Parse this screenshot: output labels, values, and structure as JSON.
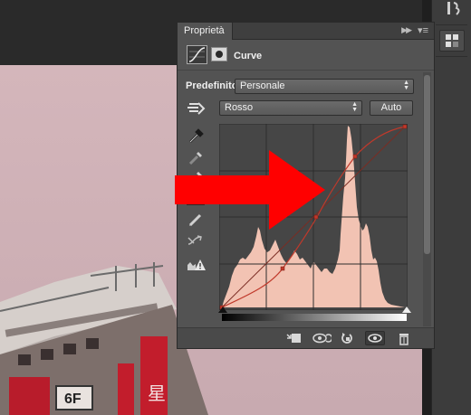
{
  "panel": {
    "tab_label": "Proprietà",
    "title": "Curve",
    "preset_label": "Predefinito:",
    "preset_value": "Personale",
    "channel_value": "Rosso",
    "auto_label": "Auto"
  },
  "dock": {
    "items": [
      "history-icon",
      "adjustments-icon"
    ]
  },
  "icons": {
    "tools": [
      "target-adjust-icon",
      "black-eyedropper-icon",
      "gray-eyedropper-icon",
      "white-eyedropper-icon",
      "edit-points-icon",
      "pencil-icon",
      "smooth-icon",
      "clipping-warning-icon"
    ],
    "bottom_bar": [
      "clip-to-layer-icon",
      "view-previous-icon",
      "reset-icon",
      "visibility-eye-icon",
      "trash-icon"
    ]
  },
  "photo": {
    "sign_text_1": "6F",
    "sign_text_2": "星"
  },
  "colors": {
    "panel_bg": "#535353",
    "curve_red": "#c0392b",
    "histogram_fill": "#f2c3b3",
    "annotation_arrow": "#ff0000"
  }
}
